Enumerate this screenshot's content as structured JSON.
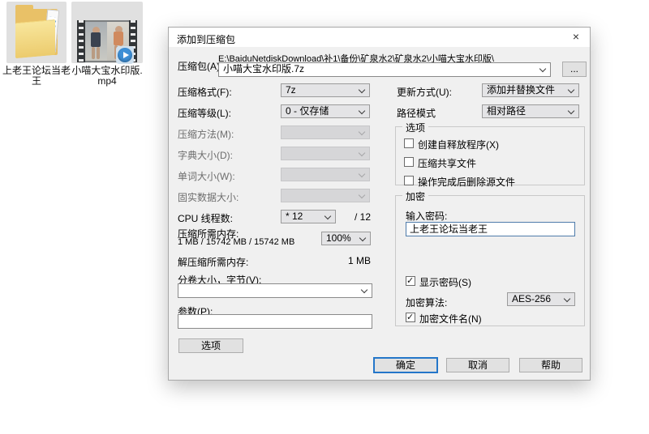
{
  "desktop": {
    "icons": [
      {
        "type": "folder",
        "label1": "上老王论坛当老",
        "label2": "王"
      },
      {
        "type": "video",
        "label1": "小喵大宝水印版.",
        "label2": "mp4"
      }
    ]
  },
  "icons": {
    "close": "×",
    "browse": "..."
  },
  "dialog": {
    "title": "添加到压缩包",
    "archive": {
      "label": "压缩包(A):",
      "dir_path": "E:\\BaiduNetdiskDownload\\补1\\备份\\矿泉水2\\矿泉水2\\小喵大宝水印版\\",
      "file_name": "小喵大宝水印版.7z"
    },
    "left": {
      "rows": [
        {
          "label": "压缩格式(F):",
          "value": "7z",
          "enabled": true
        },
        {
          "label": "压缩等级(L):",
          "value": "0 - 仅存储",
          "enabled": true
        },
        {
          "label": "压缩方法(M):",
          "value": "",
          "enabled": false
        },
        {
          "label": "字典大小(D):",
          "value": "",
          "enabled": false
        },
        {
          "label": "单词大小(W):",
          "value": "",
          "enabled": false
        },
        {
          "label": "固实数据大小:",
          "value": "",
          "enabled": false
        }
      ],
      "cpu": {
        "label": "CPU 线程数:",
        "value": "* 12",
        "suffix": "/ 12"
      },
      "mem_compress": {
        "label": "压缩所需内存:",
        "value": "1 MB / 15742 MB / 15742 MB",
        "percent": "100%"
      },
      "mem_decompress": {
        "label": "解压缩所需内存:",
        "value": "1 MB"
      },
      "volume": {
        "label": "分卷大小，字节(V):",
        "value": ""
      },
      "params": {
        "label": "参数(P):",
        "value": ""
      },
      "options_button": "选项"
    },
    "right": {
      "update_mode": {
        "label": "更新方式(U):",
        "value": "添加并替换文件"
      },
      "path_mode": {
        "label": "路径模式",
        "value": "相对路径"
      },
      "options_group": {
        "title": "选项",
        "checkboxes": [
          {
            "label": "创建自释放程序(X)",
            "checked": false
          },
          {
            "label": "压缩共享文件",
            "checked": false
          },
          {
            "label": "操作完成后删除源文件",
            "checked": false
          }
        ]
      },
      "encryption_group": {
        "title": "加密",
        "password_label": "输入密码:",
        "password_value": "上老王论坛当老王",
        "show_password": {
          "label": "显示密码(S)",
          "checked": true
        },
        "method": {
          "label": "加密算法:",
          "value": "AES-256"
        },
        "encrypt_names": {
          "label": "加密文件名(N)",
          "checked": true
        }
      }
    },
    "footer": {
      "ok": "确定",
      "cancel": "取消",
      "help": "帮助"
    }
  }
}
